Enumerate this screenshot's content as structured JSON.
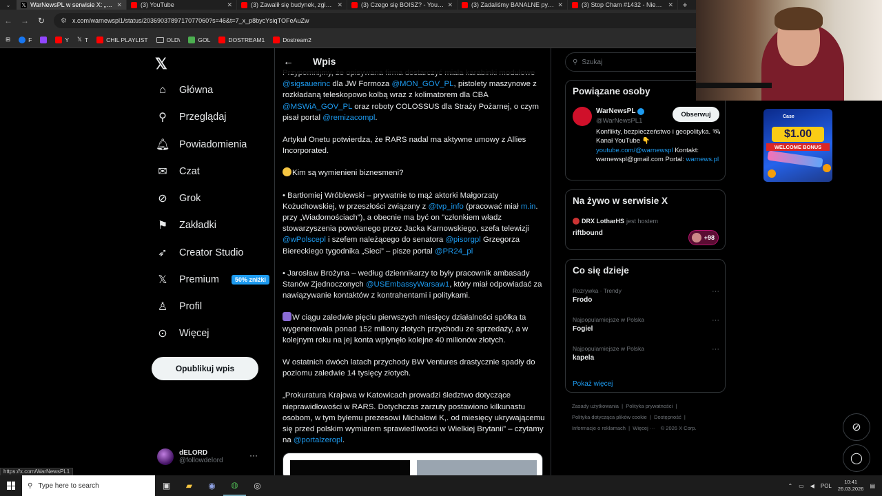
{
  "browser": {
    "tabs": [
      {
        "title": "WarNewsPL w serwisie X: „Plus",
        "icon": "x-logo-icon",
        "active": true
      },
      {
        "title": "(3) YouTube",
        "icon": "youtube-icon"
      },
      {
        "title": "(3) Zawalił się budynek, zginęło",
        "icon": "youtube-icon"
      },
      {
        "title": "(3) Czego się BOISZ? - YouTube",
        "icon": "youtube-icon"
      },
      {
        "title": "(3) Zadaliśmy BANALNE pytania",
        "icon": "youtube-icon"
      },
      {
        "title": "(3) Stop Cham #1432 - Niebezp",
        "icon": "youtube-icon"
      }
    ],
    "url": "x.com/warnewspl1/status/2036903789717077060?s=46&t=7_x_p8bycYsiqTOFeAuZw",
    "bookmarks": [
      {
        "label": "F",
        "icon": "facebook-icon"
      },
      {
        "label": "",
        "icon": "twitch-icon"
      },
      {
        "label": "Y",
        "icon": "youtube-icon"
      },
      {
        "label": "T",
        "icon": "x-logo-icon"
      },
      {
        "label": "CHIL PLAYLIST",
        "icon": "youtube-icon"
      },
      {
        "label": "OLD\\",
        "icon": "folder-icon"
      },
      {
        "label": "GOL",
        "icon": "gol-icon"
      },
      {
        "label": "DOSTREAM1",
        "icon": "youtube-icon"
      },
      {
        "label": "Dostream2",
        "icon": "youtube-icon"
      }
    ],
    "status_url": "https://x.com/WarNewsPL1"
  },
  "nav": {
    "items": [
      {
        "label": "Główna",
        "icon": "home-icon"
      },
      {
        "label": "Przeglądaj",
        "icon": "search-icon"
      },
      {
        "label": "Powiadomienia",
        "icon": "bell-icon"
      },
      {
        "label": "Czat",
        "icon": "mail-icon"
      },
      {
        "label": "Grok",
        "icon": "grok-icon"
      },
      {
        "label": "Zakładki",
        "icon": "bookmark-icon"
      },
      {
        "label": "Creator Studio",
        "icon": "rocket-icon"
      },
      {
        "label": "Premium",
        "icon": "x-logo-icon"
      },
      {
        "label": "Profil",
        "icon": "person-icon"
      },
      {
        "label": "Więcej",
        "icon": "more-circle-icon"
      }
    ],
    "premium_badge": "50% zniżki",
    "post_button": "Opublikuj wpis",
    "account": {
      "name": "dELORD",
      "handle": "@followdelord"
    }
  },
  "post": {
    "header_title": "Wpis",
    "p0_text": "Przypomnijmy, że opisywana firma dostarczyć miała karabinki modułowe ",
    "p0_m1": "@sigsauerinc",
    "p0_t2": " dla JW Formoza ",
    "p0_m2": "@MON_GOV_PL",
    "p0_t3": ", pistolety maszynowe z rozkładaną teleskopowo kolbą wraz z kolimatorem dla CBA ",
    "p0_m3": "@MSWiA_GOV_PL",
    "p0_t4": " oraz roboty COLOSSUS dla Straży Pożarnej, o czym pisał portal ",
    "p0_m4": "@remizacompl",
    "p0_t5": ".",
    "p1": "Artykuł Onetu potwierdza, że RARS nadal ma aktywne umowy z Allies Incorporated.",
    "p2": "Kim są wymienieni biznesmeni?",
    "p3_text": "• Bartłomiej Wróblewski – prywatnie to mąż aktorki Małgorzaty Kożuchowskiej, w przeszłości związany z ",
    "p3_m1": "@tvp_info",
    "p3_t2": " (pracować miał ",
    "p3_m2": "m.in",
    "p3_t3": ". przy „Wiadomościach”), a obecnie ma być on \"członkiem władz stowarzyszenia powołanego przez Jacka Karnowskiego, szefa telewizji ",
    "p3_m3": "@wPolscepl",
    "p3_t4": " i szefem należącego do senatora ",
    "p3_m4": "@pisorgpl",
    "p3_t5": " Grzegorza Biereckiego tygodnika „Sieci” – pisze portal ",
    "p3_m5": "@PR24_pl",
    "p4_text": "• Jarosław Brożyna – według dziennikarzy to były pracownik ambasady Stanów Zjednoczonych ",
    "p4_m1": "@USEmbassyWarsaw1",
    "p4_t2": ", który miał odpowiadać za nawiązywanie kontaktów z kontrahentami i politykami.",
    "p5": "W ciągu zaledwie pięciu pierwszych miesięcy działalności spółka ta wygenerowała ponad 152 miliony złotych przychodu ze sprzedaży, a w kolejnym roku na jej konta wpłynęło kolejne 40 milionów złotych.",
    "p6": "W ostatnich dwóch latach przychody BW Ventures drastycznie spadły do poziomu zaledwie 14 tysięcy złotych.",
    "p7_text": "„Prokuratura Krajowa w Katowicach prowadzi śledztwo dotyczące nieprawidłowości w RARS. Dotychczas zarzuty postawiono kilkunastu osobom, w tym byłemu prezesowi Michałowi K,. od miesięcy ukrywającemu się przed polskim wymiarem sprawiedliwości w Wielkiej Brytanii” – czytamy na ",
    "p7_m1": "@portalzeropl",
    "p7_t2": "."
  },
  "sidebar": {
    "search_placeholder": "Szukaj",
    "related_title": "Powiązane osoby",
    "related": {
      "name": "WarNewsPL",
      "handle": "@WarNewsPL1",
      "follow": "Obserwuj",
      "bio_1": "Konflikty, bezpieczeństwo i geopolityka. 🛰 Kanał YouTube 👇 ",
      "bio_link1": "youtube.com/@warnewspl",
      "bio_2": " Kontakt: warnewspl@gmail.com Portal: ",
      "bio_link2": "warnews.pl"
    },
    "live_title": "Na żywo w serwisie X",
    "live": {
      "host": "DRX LotharHS",
      "host_suffix": "jest hostem",
      "title": "riftbound",
      "count": "+98"
    },
    "trends_title": "Co się dzieje",
    "trends": [
      {
        "category": "Rozrywka · Trendy",
        "name": "Frodo"
      },
      {
        "category": "Najpopularniejsze w Polska",
        "name": "Fogiel"
      },
      {
        "category": "Najpopularniejsze w Polska",
        "name": "kapela"
      }
    ],
    "show_more": "Pokaż więcej",
    "footer_links": [
      "Zasady użytkowania",
      "Polityka prywatności",
      "Polityka dotycząca plików cookie",
      "Dostępność",
      "Informacje o reklamach",
      "Więcej ···",
      "© 2026 X Corp."
    ]
  },
  "ad": {
    "logo": "Case",
    "amount": "$1.00",
    "text": "WELCOME BONUS"
  },
  "taskbar": {
    "search_placeholder": "Type here to search",
    "lang": "POL",
    "time": "10:41",
    "date": "26.03.2026"
  },
  "colors": {
    "accent": "#1d9bf0",
    "background": "#000000",
    "border": "#2f3336"
  }
}
